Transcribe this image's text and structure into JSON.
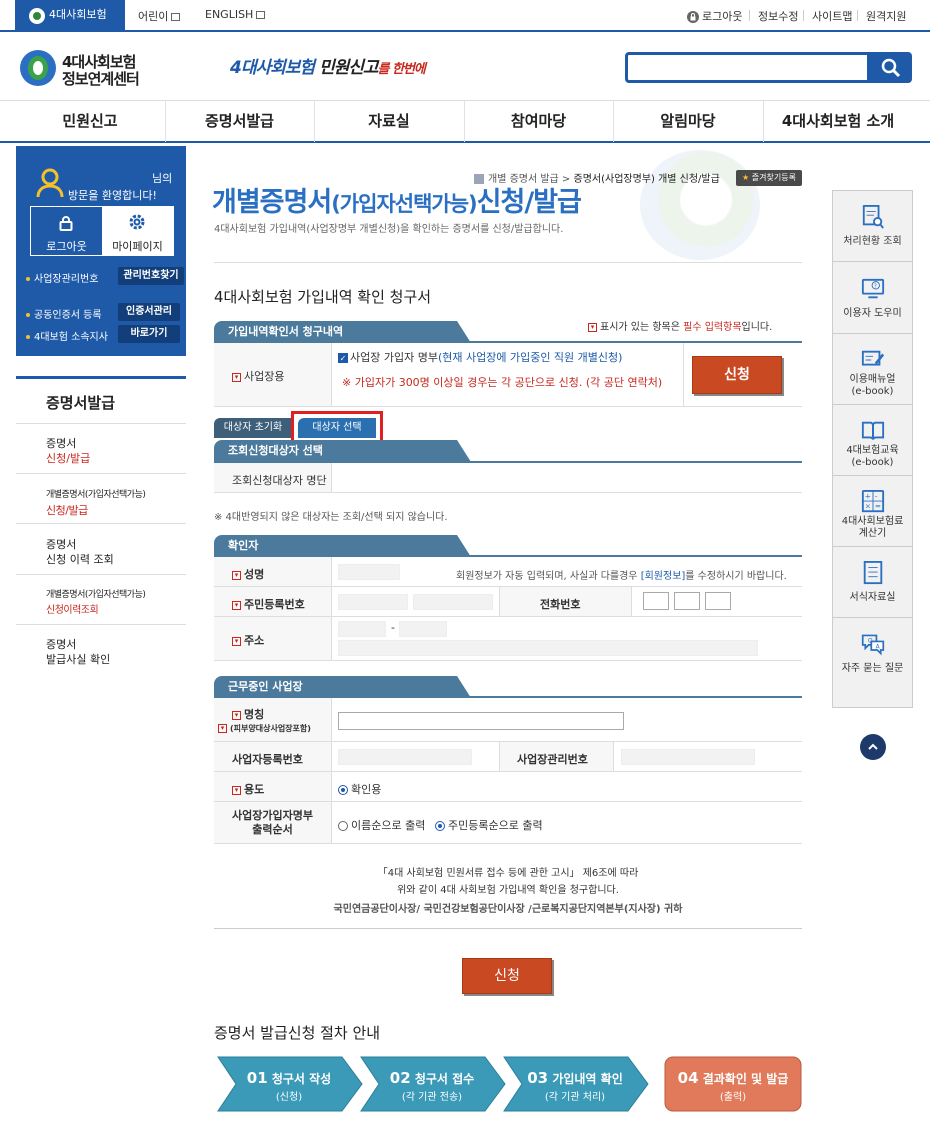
{
  "topbar": {
    "site_tab": "4대사회보험",
    "kids_link": "어린이",
    "english_link": "ENGLISH",
    "logout": "로그아웃",
    "edit_info": "정보수정",
    "sitemap": "사이트맵",
    "remote": "원격지원"
  },
  "header": {
    "logo_line1": "4대사회보험",
    "logo_line2": "정보연계센터",
    "slogan_blue": "4대사회보험",
    "slogan_black": " 민원신고",
    "slogan_red": "를 한번에",
    "search_placeholder": ""
  },
  "gnb": [
    "민원신고",
    "증명서발급",
    "자료실",
    "참여마당",
    "알림마당",
    "4대사회보험 소개"
  ],
  "sidebar": {
    "nim": "님의",
    "welcome": "방문을 환영합니다!",
    "logout_btn": "로그아웃",
    "mypage_btn": "마이페이지",
    "biz_no_label": "사업장관리번호",
    "biz_no_btn": "관리번호찾기",
    "cert_label": "공동인증서 등록",
    "cert_btn": "인증서관리",
    "branch_label": "4대보험 소속지사",
    "branch_btn": "바로가기",
    "menu_title": "증명서발급",
    "menu": [
      {
        "line1": "증명서",
        "line2": "신청/발급"
      },
      {
        "line1": "개별증명서(가입자선택가능)",
        "line2": "신청/발급"
      },
      {
        "line1": "증명서",
        "line2": "신청 이력 조회"
      },
      {
        "line1": "개별증명서(가입자선택가능)",
        "line2": "신청이력조회"
      },
      {
        "line1": "증명서",
        "line2": "발급사실 확인"
      }
    ]
  },
  "breadcrumb": {
    "prefix": "개별 증명서 발급 > ",
    "current": "증명서(사업장명부) 개별 신청/발급",
    "fav": "즐겨찾기등록"
  },
  "page": {
    "title_main": "개별증명서",
    "title_paren": "(가입자선택가능)",
    "title_end": "신청/발급",
    "desc": "4대사회보험 가입내역(사업장명부 개별신청)을 확인하는 증명서를 신청/발급합니다.",
    "form_title": "4대사회보험 가입내역 확인 청구서"
  },
  "section1": {
    "tab": "가입내역확인서 청구내역",
    "req_note_pre": "표시가 있는 항목은 ",
    "req_note_red": "필수 입력항목",
    "req_note_post": "입니다.",
    "label": "사업장용",
    "check_label": "사업장 가입자 명부",
    "check_note": "(현재 사업장에 가입중인 직원 개별신청)",
    "warning": "※ 가입자가 300명 이상일 경우는 각 공단으로 신청. (각 공단 연락처)",
    "apply_btn": "신청"
  },
  "target": {
    "reset_btn": "대상자 초기화",
    "select_btn": "대상자 선택",
    "tab": "조회신청대상자 선택",
    "list_label": "조회신청대상자 명단",
    "footnote": "※ 4대반영되지 않은 대상자는 조회/선택 되지 않습니다."
  },
  "confirmer": {
    "tab": "확인자",
    "name_label": "성명",
    "name_note_pre": "회원정보가 자동 입력되며, 사실과 다를경우 ",
    "name_note_link": "[회원정보]",
    "name_note_post": "를 수정하시기 바랍니다.",
    "rrn_label": "주민등록번호",
    "phone_label": "전화번호",
    "addr_label": "주소",
    "addr_dash": "-"
  },
  "workplace": {
    "tab": "근무중인 사업장",
    "name_label": "명칭",
    "name_sub": "(피부양대상사업장포함)",
    "bizreg_label": "사업자등록번호",
    "bizmgmt_label": "사업장관리번호",
    "purpose_label": "용도",
    "purpose_value": "확인용",
    "order_label_1": "사업장가입자명부",
    "order_label_2": "출력순서",
    "order_opt1": "이름순으로 출력",
    "order_opt2": "주민등록순으로 출력"
  },
  "notice": {
    "line1": "「4대 사회보험 민원서류 접수 등에 관한 고시」 제6조에 따라",
    "line2": "위와 같이 4대 사회보험 가입내역 확인을 청구합니다.",
    "line3": "국민연금공단이사장/ 국민건강보험공단이사장 /근로복지공단지역본부(지사장) 귀하"
  },
  "apply_btn2": "신청",
  "process": {
    "title": "증명서 발급신청 절차 안내",
    "steps": [
      {
        "num": "01",
        "title": "청구서 작성",
        "sub": "(신청)"
      },
      {
        "num": "02",
        "title": "청구서 접수",
        "sub": "(각 기관 전송)"
      },
      {
        "num": "03",
        "title": "가입내역 확인",
        "sub": "(각 기관 처리)"
      },
      {
        "num": "04",
        "title": "결과확인 및 발급",
        "sub": "(출력)"
      }
    ]
  },
  "quick": [
    {
      "label": "처리현황 조회",
      "icon": "document-search-icon"
    },
    {
      "label": "이용자 도우미",
      "icon": "help-monitor-icon"
    },
    {
      "label": "이용매뉴얼\n(e-book)",
      "icon": "manual-edit-icon"
    },
    {
      "label": "4대보험교육\n(e-book)",
      "icon": "book-icon"
    },
    {
      "label": "4대사회보험료\n계산기",
      "icon": "calculator-icon"
    },
    {
      "label": "서식자료실",
      "icon": "form-list-icon"
    },
    {
      "label": "자주 묻는 질문",
      "icon": "faq-bubble-icon"
    }
  ],
  "colors": {
    "primary": "#1e5aa8",
    "accent_red": "#c94a22",
    "section_tab": "#4b7a9c",
    "highlight": "#e02020"
  }
}
